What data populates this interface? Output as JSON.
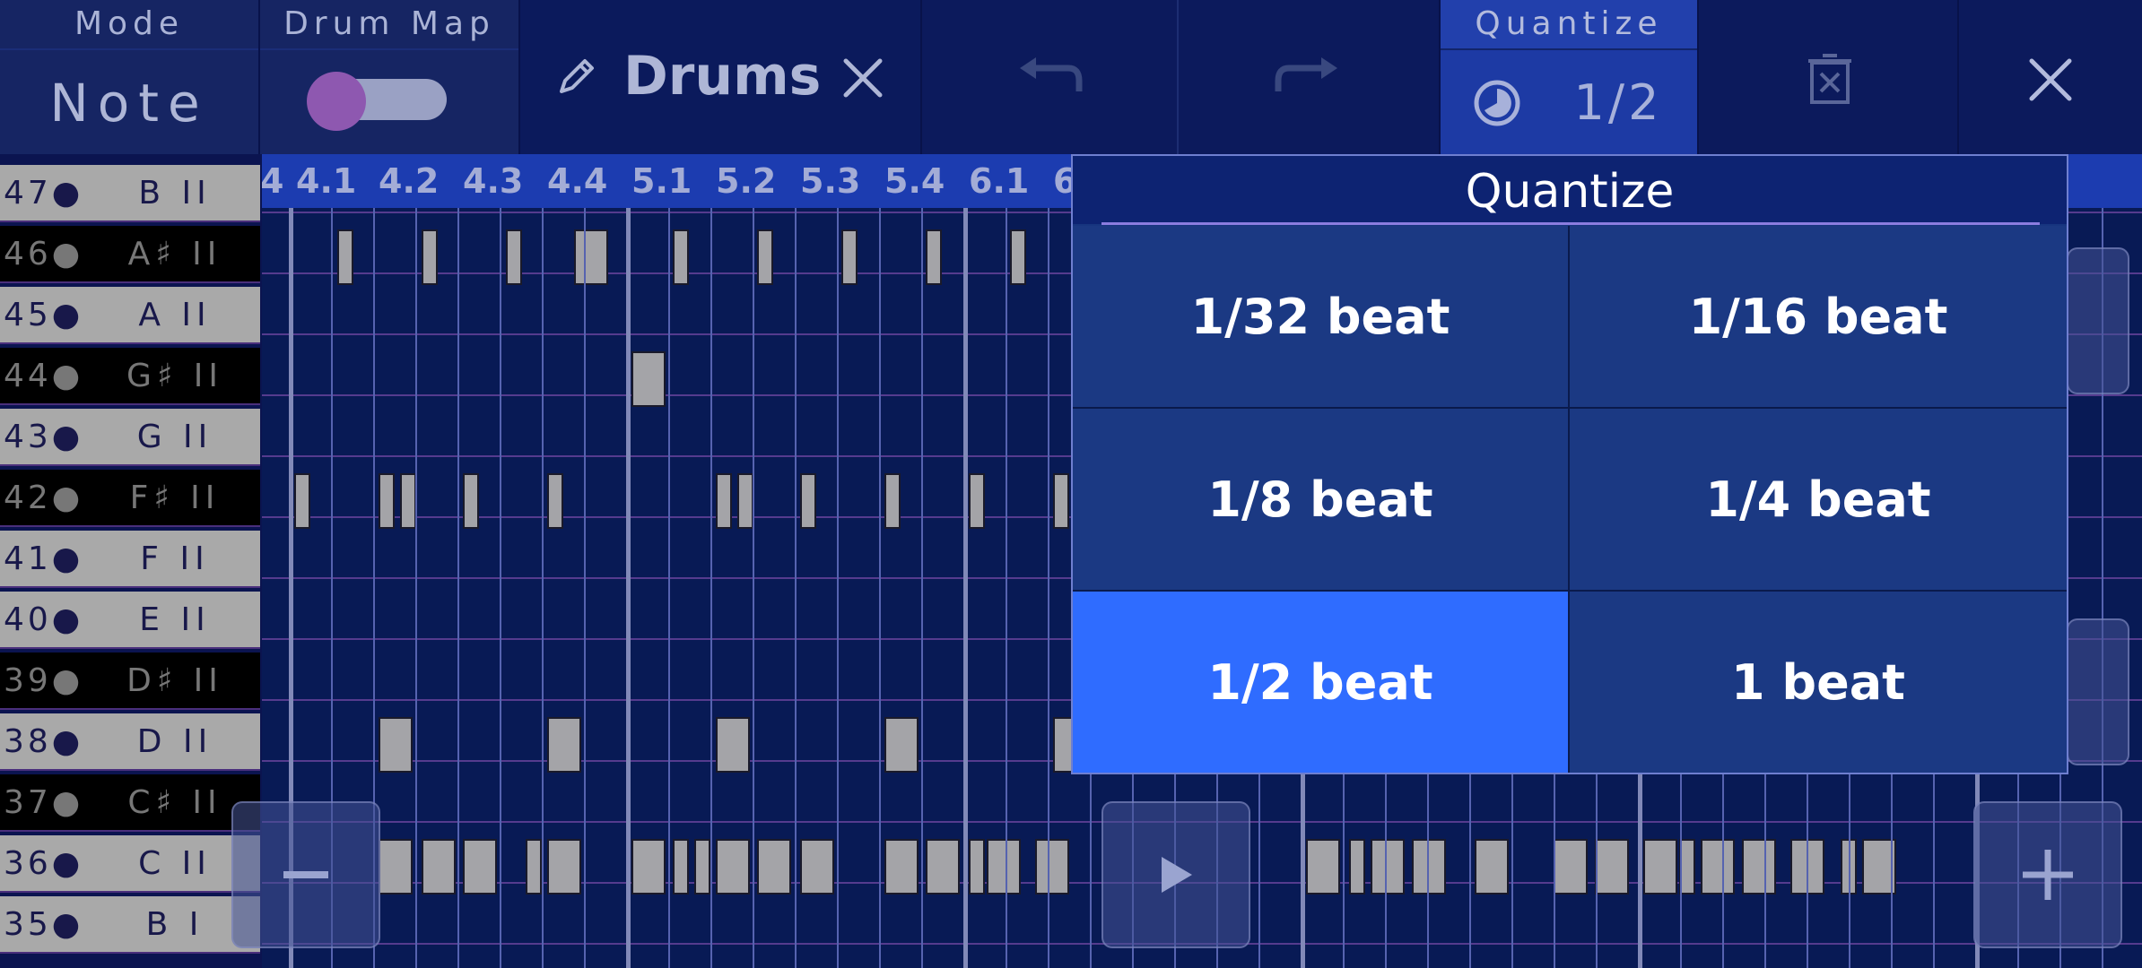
{
  "header": {
    "mode_label": "Mode",
    "mode_value": "Note",
    "drum_map_label": "Drum Map",
    "track_name": "Drums",
    "quantize_label": "Quantize",
    "quantize_value": "1/2"
  },
  "ruler": {
    "ticks": [
      "4",
      "4.1",
      "4.2",
      "4.3",
      "4.4",
      "5.1",
      "5.2",
      "5.3",
      "5.4",
      "6.1",
      "6"
    ]
  },
  "keys": [
    {
      "num": "47●",
      "name": "B II",
      "type": "white"
    },
    {
      "num": "46●",
      "name": "A♯ II",
      "type": "black"
    },
    {
      "num": "45●",
      "name": "A II",
      "type": "white"
    },
    {
      "num": "44●",
      "name": "G♯ II",
      "type": "black"
    },
    {
      "num": "43●",
      "name": "G II",
      "type": "white"
    },
    {
      "num": "42●",
      "name": "F♯ II",
      "type": "black"
    },
    {
      "num": "41●",
      "name": "F II",
      "type": "white"
    },
    {
      "num": "40●",
      "name": "E II",
      "type": "white"
    },
    {
      "num": "39●",
      "name": "D♯ II",
      "type": "black"
    },
    {
      "num": "38●",
      "name": "D II",
      "type": "white"
    },
    {
      "num": "37●",
      "name": "C♯ II",
      "type": "black"
    },
    {
      "num": "36●",
      "name": "C II",
      "type": "white"
    },
    {
      "num": "35●",
      "name": "B I",
      "type": "white"
    }
  ],
  "quantize_popup": {
    "title": "Quantize",
    "options": [
      "1/32 beat",
      "1/16 beat",
      "1/8 beat",
      "1/4 beat",
      "1/2 beat",
      "1 beat"
    ],
    "selected": "1/2 beat"
  },
  "colors": {
    "background": "#081a55",
    "accent": "#2f6cff",
    "note": "#a4a4a8"
  }
}
